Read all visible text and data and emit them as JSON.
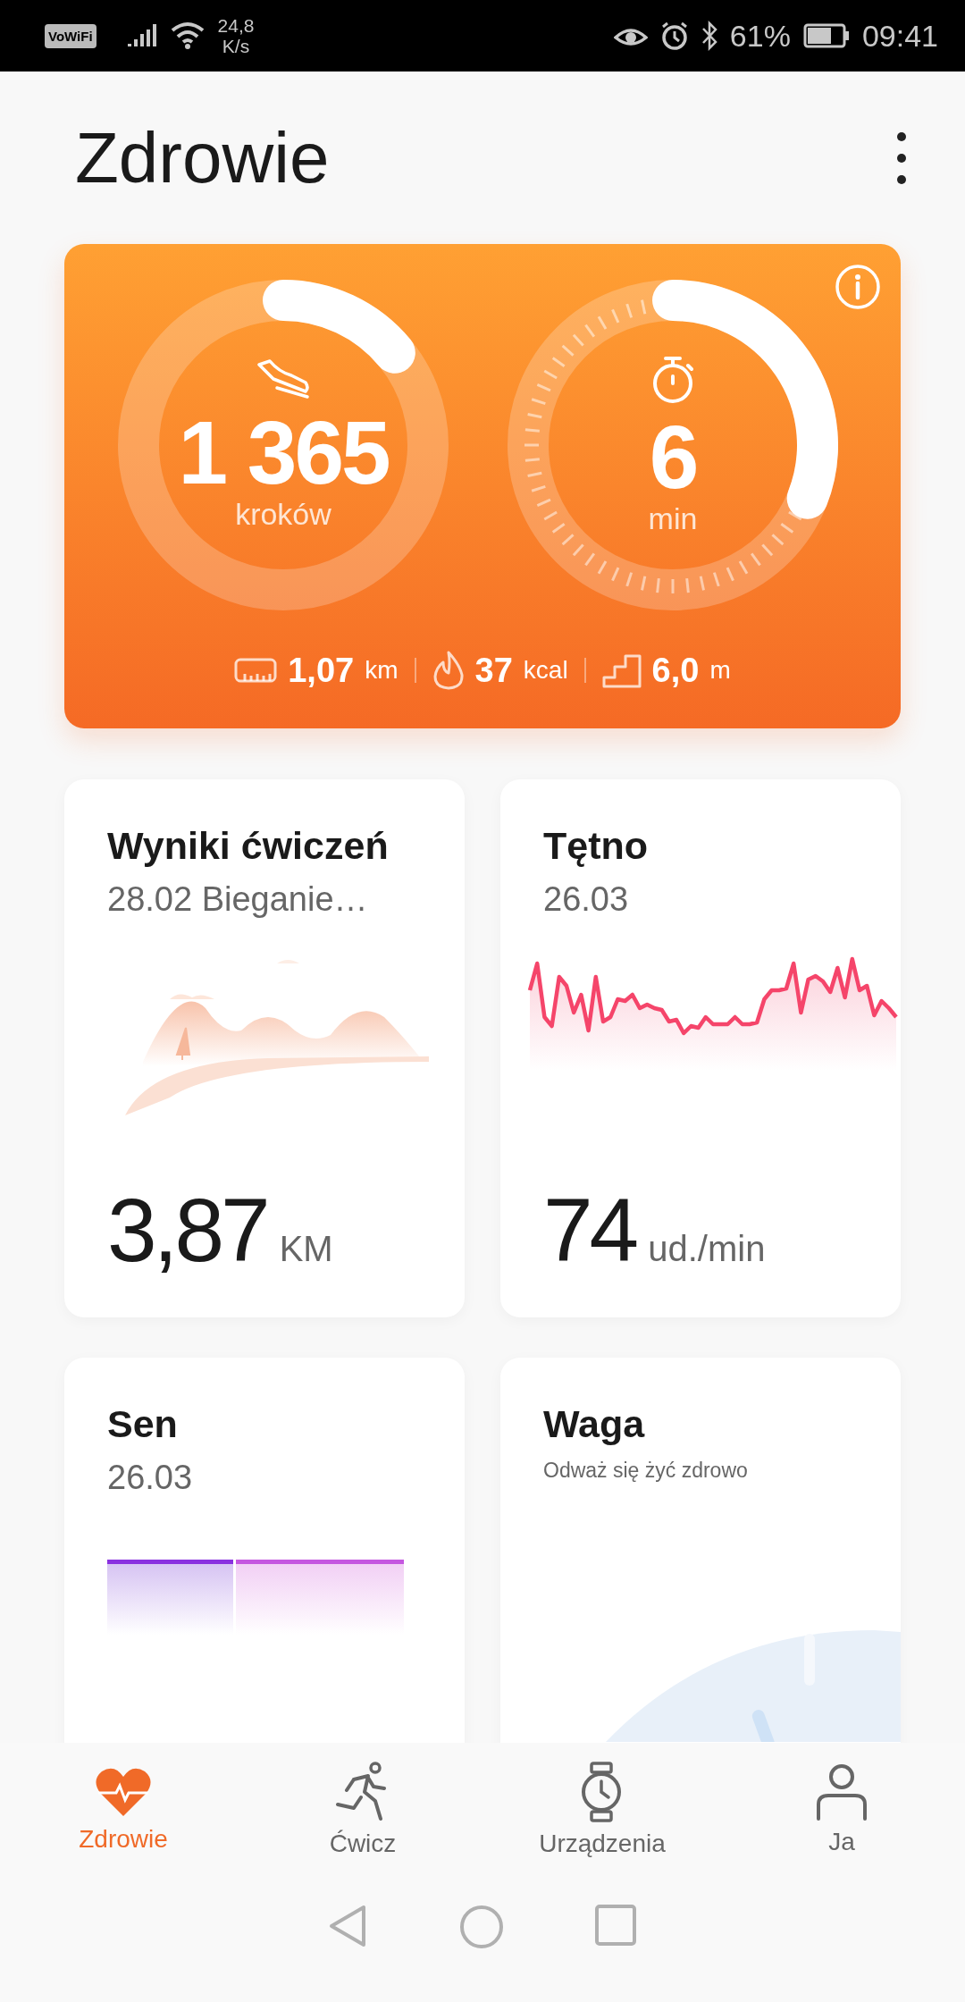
{
  "status_bar": {
    "vowifi": "VoWiFi",
    "speed": "24,8",
    "speed_unit": "K/s",
    "battery": "61%",
    "time": "09:41"
  },
  "header": {
    "title": "Zdrowie"
  },
  "activity": {
    "rings": [
      {
        "kind": "steps",
        "value": "1 365",
        "unit": "kroków"
      },
      {
        "kind": "time",
        "value": "6",
        "unit": "min"
      }
    ],
    "stats": [
      {
        "kind": "distance",
        "value": "1,07",
        "unit": "km"
      },
      {
        "kind": "calories",
        "value": "37",
        "unit": "kcal"
      },
      {
        "kind": "floors",
        "value": "6,0",
        "unit": "m"
      }
    ]
  },
  "cards": [
    {
      "kind": "workout",
      "title": "Wyniki ćwiczeń",
      "subtitle": "28.02 Bieganie…",
      "value": "3,87",
      "unit": "KM"
    },
    {
      "kind": "heart_rate",
      "title": "Tętno",
      "subtitle": "26.03",
      "value": "74",
      "unit": "ud./min"
    },
    {
      "kind": "sleep",
      "title": "Sen",
      "subtitle": "26.03"
    },
    {
      "kind": "weight",
      "title": "Waga",
      "note": "Odważ się żyć zdrowo"
    }
  ],
  "nav": [
    {
      "kind": "health",
      "label": "Zdrowie",
      "selected": true
    },
    {
      "kind": "exercise",
      "label": "Ćwicz",
      "selected": false
    },
    {
      "kind": "devices",
      "label": "Urządzenia",
      "selected": false
    },
    {
      "kind": "me",
      "label": "Ja",
      "selected": false
    }
  ]
}
